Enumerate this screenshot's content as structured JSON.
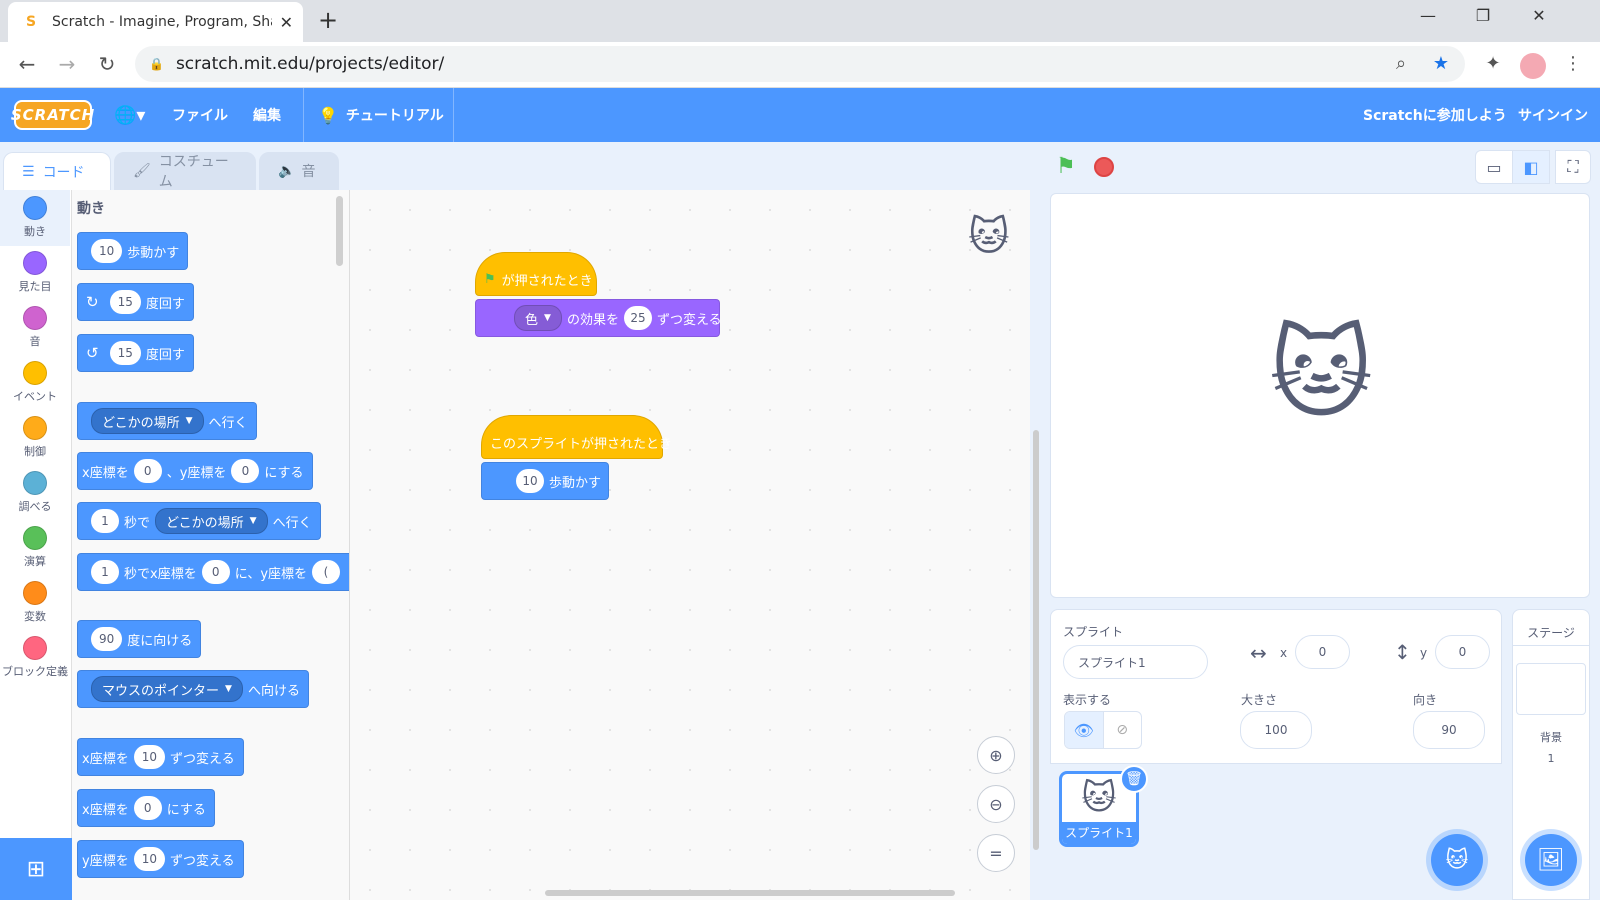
{
  "browser": {
    "tab_title": "Scratch - Imagine, Program, Shar",
    "favicon": "S",
    "url": "scratch.mit.edu/projects/editor/"
  },
  "menubar": {
    "logo": "SCRATCH",
    "file": "ファイル",
    "edit": "編集",
    "tutorials": "チュートリアル",
    "join": "Scratchに参加しよう",
    "signin": "サインイン"
  },
  "editor_tabs": {
    "code": "コード",
    "costumes": "コスチューム",
    "sounds": "音"
  },
  "categories": [
    {
      "label": "動き",
      "color": "#4c97ff"
    },
    {
      "label": "見た目",
      "color": "#9966ff"
    },
    {
      "label": "音",
      "color": "#cf63cf"
    },
    {
      "label": "イベント",
      "color": "#ffbf00"
    },
    {
      "label": "制御",
      "color": "#ffab19"
    },
    {
      "label": "調べる",
      "color": "#5cb1d6"
    },
    {
      "label": "演算",
      "color": "#59c059"
    },
    {
      "label": "変数",
      "color": "#ff8c1a"
    },
    {
      "label": "ブロック定義",
      "color": "#ff6680"
    }
  ],
  "palette": {
    "heading": "動き",
    "move": {
      "value": "10",
      "text": "歩動かす"
    },
    "turn_right": {
      "value": "15",
      "text": "度回す"
    },
    "turn_left": {
      "value": "15",
      "text": "度回す"
    },
    "goto": {
      "menu": "どこかの場所",
      "text": "へ行く"
    },
    "gotoxy": {
      "xlabel": "x座標を",
      "x": "0",
      "sep": "、y座標を",
      "y": "0",
      "text": "にする"
    },
    "glide": {
      "secs": "1",
      "mid": "秒で",
      "menu": "どこかの場所",
      "text": "へ行く"
    },
    "glidexy": {
      "secs": "1",
      "mid": "秒でx座標を",
      "x": "0",
      "text": "に、y座標を",
      "y": "("
    },
    "point": {
      "value": "90",
      "text": "度に向ける"
    },
    "pointto": {
      "menu": "マウスのポインター",
      "text": "へ向ける"
    },
    "changex": {
      "label": "x座標を",
      "value": "10",
      "text": "ずつ変える"
    },
    "setx": {
      "label": "x座標を",
      "value": "0",
      "text": "にする"
    },
    "changey": {
      "label": "y座標を",
      "value": "10",
      "text": "ずつ変える"
    }
  },
  "script": {
    "hat1": "が押されたとき",
    "effect": {
      "menu": "色",
      "mid": "の効果を",
      "value": "25",
      "text": "ずつ変える"
    },
    "hat2": "このスプライトが押されたとき",
    "move": {
      "value": "10",
      "text": "歩動かす"
    }
  },
  "sprite_info": {
    "sprite_label": "スプライト",
    "sprite_name": "スプライト1",
    "x_label": "x",
    "x": "0",
    "y_label": "y",
    "y": "0",
    "show_label": "表示する",
    "size_label": "大きさ",
    "size": "100",
    "direction_label": "向き",
    "direction": "90",
    "thumb_name": "スプライト1"
  },
  "stage_pane": {
    "title": "ステージ",
    "backdrops_label": "背景",
    "backdrops_count": "1"
  }
}
